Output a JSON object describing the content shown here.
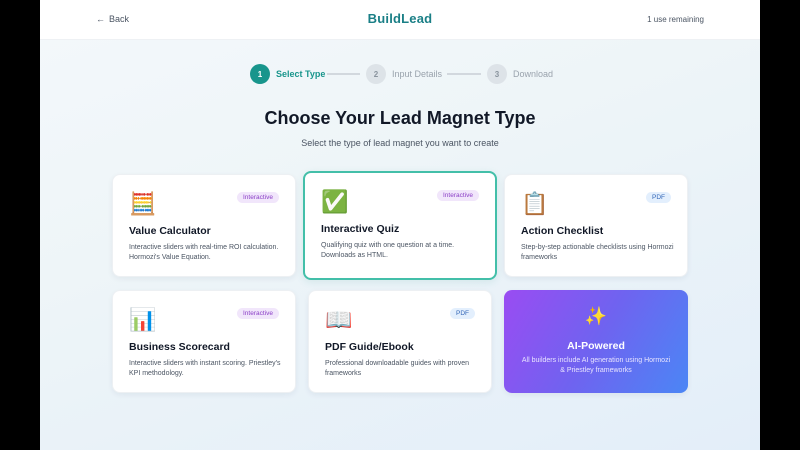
{
  "header": {
    "back_label": "Back",
    "brand": "BuildLead",
    "uses_remaining": "1 use remaining"
  },
  "stepper": {
    "steps": [
      {
        "number": "1",
        "label": "Select Type",
        "state": "active"
      },
      {
        "number": "2",
        "label": "Input Details",
        "state": "inactive"
      },
      {
        "number": "3",
        "label": "Download",
        "state": "inactive"
      }
    ]
  },
  "main": {
    "title": "Choose Your Lead Magnet Type",
    "subtitle": "Select the type of lead magnet you want to create"
  },
  "cards": [
    {
      "icon": "abacus-icon",
      "emoji": "🧮",
      "badge": "Interactive",
      "title": "Value Calculator",
      "desc": "Interactive sliders with real-time ROI calculation. Hormozi's Value Equation."
    },
    {
      "icon": "check-mark-icon",
      "emoji": "✅",
      "badge": "Interactive",
      "title": "Interactive Quiz",
      "desc": "Qualifying quiz with one question at a time. Downloads as HTML.",
      "selected": true
    },
    {
      "icon": "clipboard-icon",
      "emoji": "📋",
      "badge": "PDF",
      "title": "Action Checklist",
      "desc": "Step-by-step actionable checklists using Hormozi frameworks"
    },
    {
      "icon": "bar-chart-icon",
      "emoji": "📊",
      "badge": "Interactive",
      "title": "Business Scorecard",
      "desc": "Interactive sliders with instant scoring. Priestley's KPI methodology."
    },
    {
      "icon": "open-book-icon",
      "emoji": "📖",
      "badge": "PDF",
      "title": "PDF Guide/Ebook",
      "desc": "Professional downloadable guides with proven frameworks"
    }
  ],
  "ai_card": {
    "icon": "sparkles-icon",
    "emoji": "✨",
    "title": "AI-Powered",
    "desc": "All builders include AI generation using Hormozi & Priestley frameworks"
  },
  "colors": {
    "brand": "#1a7f86",
    "active_step": "#18958c",
    "selected_border": "#43bfa9",
    "interactive_badge": "#8b3fc7",
    "pdf_badge": "#3467b8",
    "ai_gradient_start": "#9a4cf2",
    "ai_gradient_end": "#4b86f5"
  }
}
